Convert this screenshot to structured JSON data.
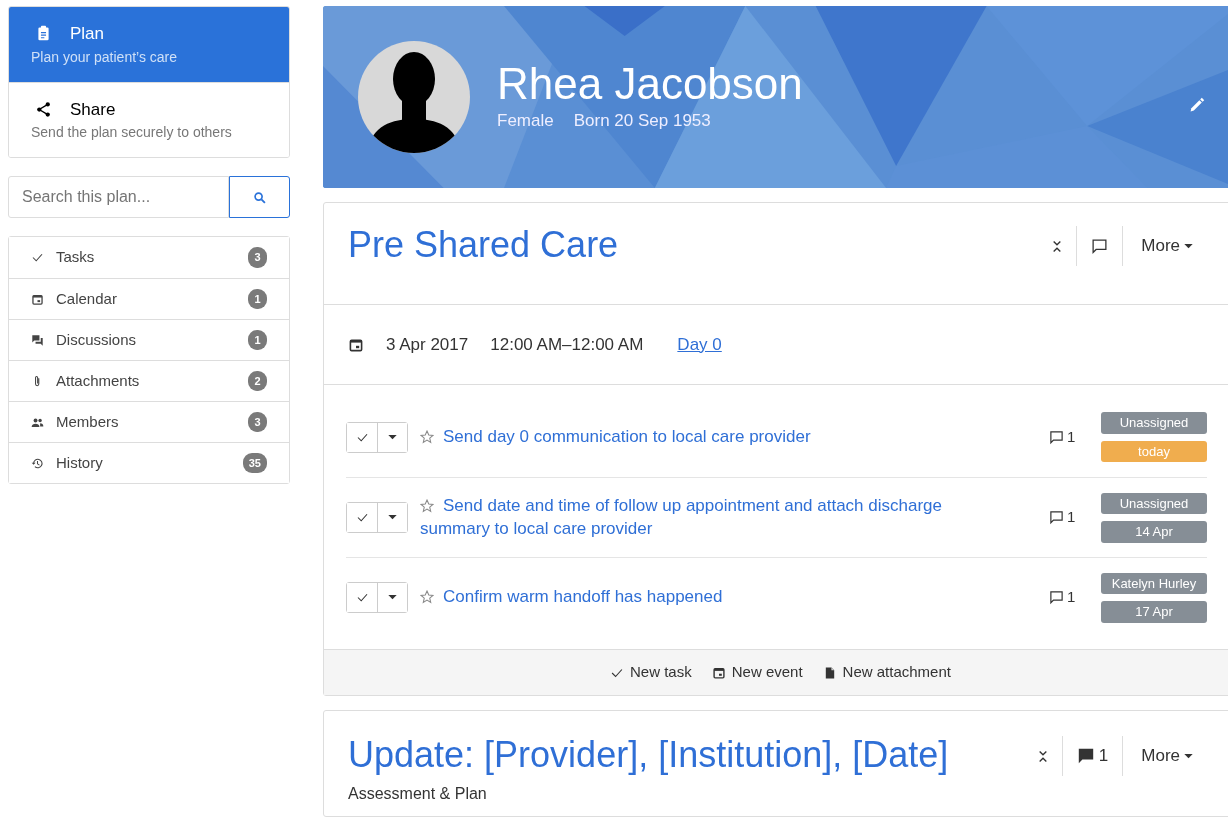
{
  "nav": [
    {
      "kind": "clipboard",
      "title": "Plan",
      "subtitle": "Plan your patient’s care",
      "selected": true
    },
    {
      "kind": "share",
      "title": "Share",
      "subtitle": "Send the plan securely to others",
      "selected": false
    }
  ],
  "search": {
    "placeholder": "Search this plan..."
  },
  "sections": [
    {
      "kind": "check",
      "label": "Tasks",
      "count": "3"
    },
    {
      "kind": "calendar",
      "label": "Calendar",
      "count": "1"
    },
    {
      "kind": "chat",
      "label": "Discussions",
      "count": "1"
    },
    {
      "kind": "clip",
      "label": "Attachments",
      "count": "2"
    },
    {
      "kind": "people",
      "label": "Members",
      "count": "3"
    },
    {
      "kind": "history",
      "label": "History",
      "count": "35"
    }
  ],
  "patient": {
    "name": "Rhea Jacobson",
    "gender": "Female",
    "born": "Born 20 Sep 1953"
  },
  "cards": [
    {
      "title": "Pre Shared Care",
      "more": "More",
      "event": {
        "date": "3 Apr 2017",
        "time": "12:00 AM–12:00 AM",
        "day": "Day 0"
      },
      "tasks": [
        {
          "title": "Send day 0 communication to local care provider",
          "starred": false,
          "comments": "1",
          "assignee": "Unassigned",
          "due": {
            "label": "today",
            "color": "#f0ad4e"
          }
        },
        {
          "title": "Send date and time of follow up appointment and attach discharge summary to local care provider",
          "starred": false,
          "comments": "1",
          "assignee": "Unassigned",
          "due": {
            "label": "14 Apr",
            "color": "#868e96"
          }
        },
        {
          "title": "Confirm warm handoff has happened",
          "starred": false,
          "comments": "1",
          "assignee": "Katelyn Hurley",
          "due": {
            "label": "17 Apr",
            "color": "#868e96"
          }
        }
      ],
      "actions": [
        {
          "kind": "check",
          "label": "New task"
        },
        {
          "kind": "calendar",
          "label": "New event"
        },
        {
          "kind": "file",
          "label": "New attachment"
        }
      ]
    },
    {
      "title": "Update: [Provider], [Institution], [Date]",
      "comments": "1",
      "more": "More",
      "body": "Assessment & Plan"
    }
  ]
}
